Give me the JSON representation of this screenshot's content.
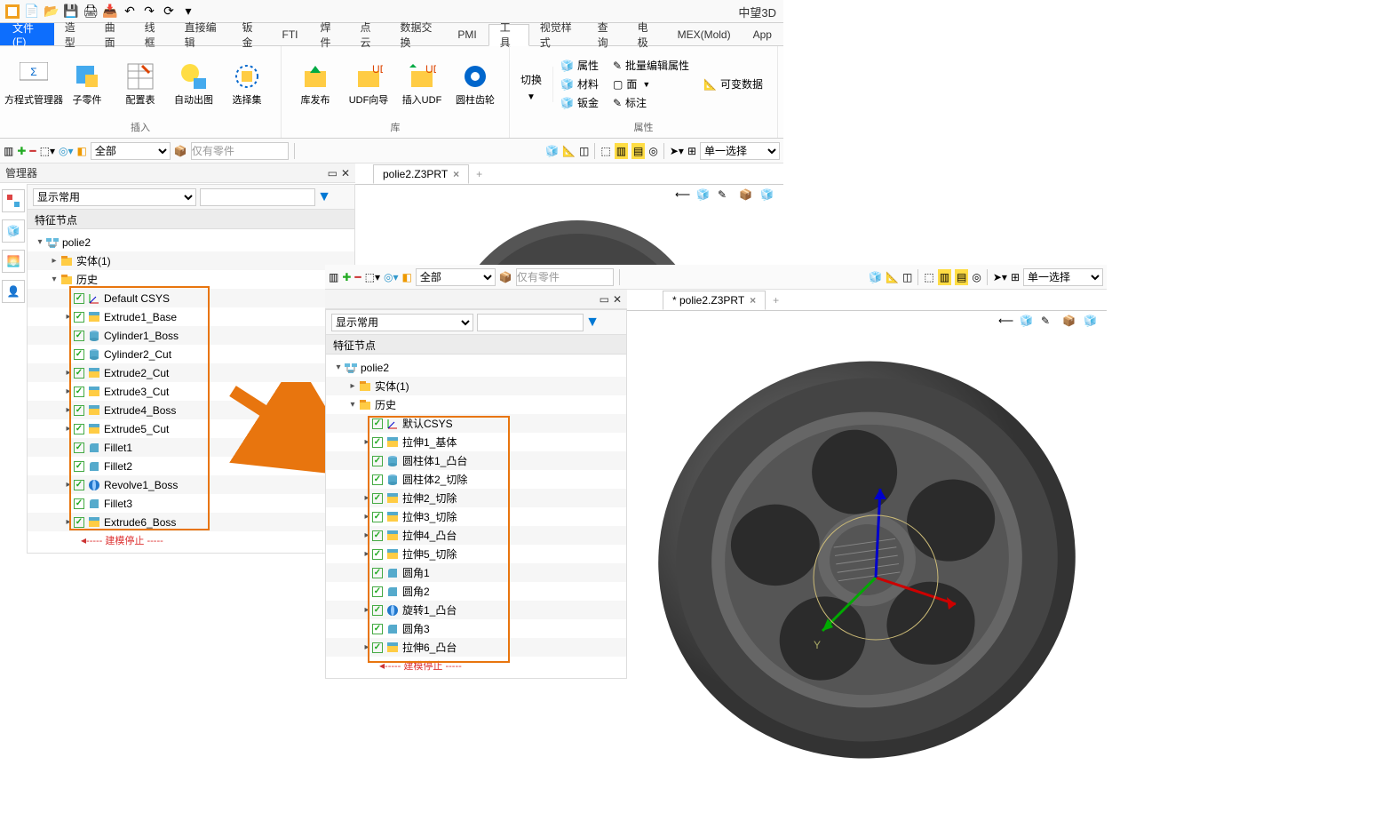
{
  "app_title": "中望3D",
  "file_menu": "文件(F)",
  "tabs": [
    "造型",
    "曲面",
    "线框",
    "直接编辑",
    "钣金",
    "FTI",
    "焊件",
    "点云",
    "数据交换",
    "PMI",
    "工具",
    "视觉样式",
    "查询",
    "电极",
    "MEX(Mold)",
    "App"
  ],
  "active_tab_index": 10,
  "ribbon": {
    "insert": {
      "title": "插入",
      "items": [
        "方程式管理器",
        "子零件",
        "配置表",
        "自动出图",
        "选择集"
      ]
    },
    "lib": {
      "title": "库",
      "items": [
        "库发布",
        "UDF向导",
        "插入UDF",
        "圆柱齿轮"
      ]
    },
    "switch_label": "切换",
    "attr": {
      "title": "属性",
      "rows": [
        [
          "属性",
          "批量编辑属性",
          "可变数据"
        ],
        [
          "材料",
          "面"
        ],
        [
          "钣金",
          "标注"
        ]
      ]
    }
  },
  "tb_filter_all": "全部",
  "tb_parts_only": "仅有零件",
  "tb_single_sel": "单一选择",
  "manager_title": "管理器",
  "display_common": "显示常用",
  "feature_node": "特征节点",
  "panel1": {
    "doc_tab": "polie2.Z3PRT",
    "root": "polie2",
    "entities": "实体(1)",
    "history": "历史",
    "features": [
      "Default CSYS",
      "Extrude1_Base",
      "Cylinder1_Boss",
      "Cylinder2_Cut",
      "Extrude2_Cut",
      "Extrude3_Cut",
      "Extrude4_Boss",
      "Extrude5_Cut",
      "Fillet1",
      "Fillet2",
      "Revolve1_Boss",
      "Fillet3",
      "Extrude6_Boss"
    ],
    "stop": "----- 建模停止 -----"
  },
  "panel2": {
    "doc_tab": "* polie2.Z3PRT",
    "root": "polie2",
    "entities": "实体(1)",
    "history": "历史",
    "features": [
      "默认CSYS",
      "拉伸1_基体",
      "圆柱体1_凸台",
      "圆柱体2_切除",
      "拉伸2_切除",
      "拉伸3_切除",
      "拉伸4_凸台",
      "拉伸5_切除",
      "圆角1",
      "圆角2",
      "旋转1_凸台",
      "圆角3",
      "拉伸6_凸台"
    ],
    "stop": "----- 建模停止 -----"
  }
}
